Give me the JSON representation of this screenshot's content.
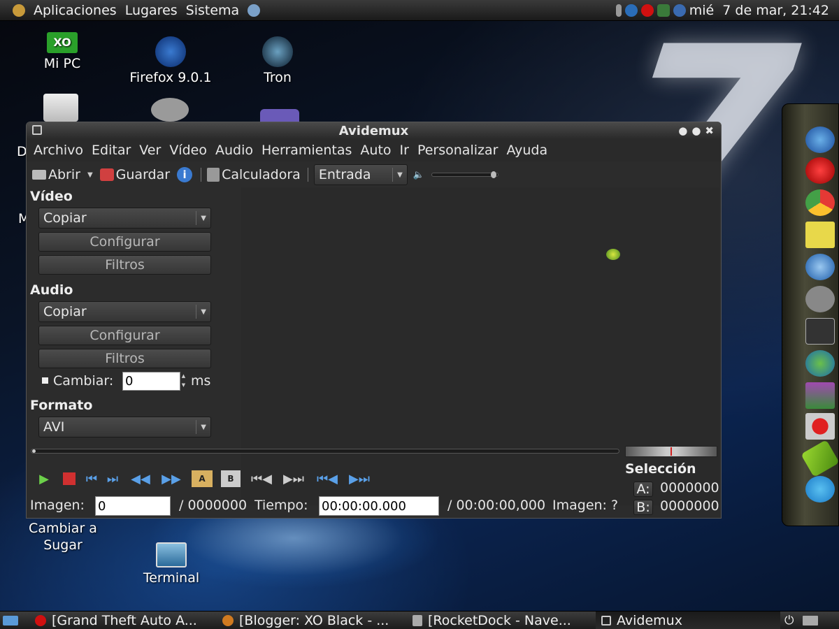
{
  "top_panel": {
    "menus": [
      "Aplicaciones",
      "Lugares",
      "Sistema"
    ],
    "clock": "mié  7 de mar, 21:42"
  },
  "desktop": {
    "icons": [
      {
        "label": "Mi PC"
      },
      {
        "label": "Firefox 9.0.1"
      },
      {
        "label": "Tron"
      },
      {
        "label": "Cambiar a Sugar"
      },
      {
        "label": "Terminal"
      }
    ],
    "partial_texts": [
      "D",
      "M"
    ]
  },
  "window": {
    "title": "Avidemux",
    "menu": [
      "Archivo",
      "Editar",
      "Ver",
      "Vídeo",
      "Audio",
      "Herramientas",
      "Auto",
      "Ir",
      "Personalizar",
      "Ayuda"
    ],
    "toolbar": {
      "open": "Abrir",
      "save": "Guardar",
      "calculator": "Calculadora",
      "view_mode": "Entrada"
    },
    "video": {
      "heading": "Vídeo",
      "codec": "Copiar",
      "configure": "Configurar",
      "filters": "Filtros"
    },
    "audio": {
      "heading": "Audio",
      "codec": "Copiar",
      "configure": "Configurar",
      "filters": "Filtros",
      "shift_label": "Cambiar:",
      "shift_value": "0",
      "shift_unit": "ms"
    },
    "format": {
      "heading": "Formato",
      "container": "AVI"
    },
    "selection": {
      "heading": "Selección",
      "a_label": "A:",
      "a_value": "0000000",
      "b_label": "B:",
      "b_value": "0000000"
    },
    "status": {
      "frame_label": "Imagen:",
      "frame_value": "0",
      "frame_total": "/ 0000000",
      "time_label": "Tiempo:",
      "time_value": "00:00:00.000",
      "time_total": "/ 00:00:00,000",
      "frame_type": "Imagen: ?"
    }
  },
  "taskbar": {
    "tasks": [
      {
        "label": "[Grand Theft Auto A..."
      },
      {
        "label": "[Blogger: XO Black - ..."
      },
      {
        "label": "[RocketDock - Nave..."
      },
      {
        "label": "Avidemux"
      }
    ]
  }
}
